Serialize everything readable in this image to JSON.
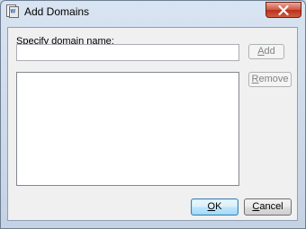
{
  "window": {
    "title": "Add Domains",
    "close_icon": "close-icon",
    "app_icon": "domains-app-icon"
  },
  "form": {
    "domain_label": "Specify domain name:",
    "domain_value": "",
    "domain_placeholder": ""
  },
  "domains_list": {
    "items": []
  },
  "buttons": {
    "add_accel": "A",
    "add_rest": "dd",
    "remove_accel": "R",
    "remove_rest": "emove",
    "ok_accel": "O",
    "ok_rest": "K",
    "cancel_accel": "C",
    "cancel_rest": "ancel"
  },
  "colors": {
    "close_button": "#c94a35",
    "default_button_border": "#3c7fb1",
    "dialog_background": "#f0f0f0"
  }
}
